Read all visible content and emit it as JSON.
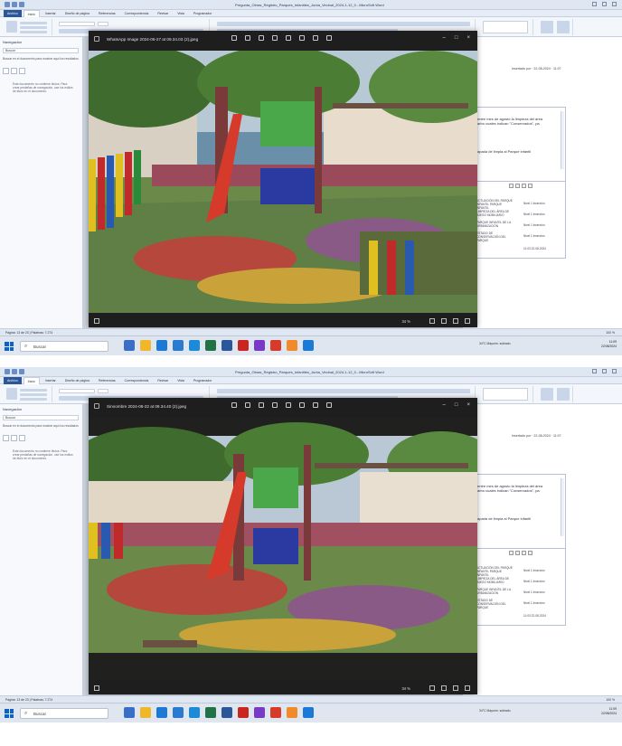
{
  "shots": [
    {
      "window_title": "Pregunta_Obras_Registro_Parques_Infantiles_Junta_Vecinal_2024-1-12_0...MicroSoft Word",
      "ribbon_tabs": [
        "Archivo",
        "Inicio",
        "Insertar",
        "Diseño de página",
        "Referencias",
        "Correspondencia",
        "Revisar",
        "Vista",
        "Programador"
      ],
      "nav": {
        "title": "Navegación",
        "search_placeholder": "Buscar",
        "hint": "Buscar en el documento para mostrar aquí los resultados",
        "detail": "Este documento no contiene títulos. Para crear pestañas de navegación, use los estilos de título en el documento."
      },
      "photo": {
        "title": "WhatsApp Image 2024-06-27 at 09.34.03 (2).jpeg",
        "zoom": "34 %"
      },
      "comment": {
        "line1": "entre mes de agosto la limpieza del área",
        "line2": "arbo cuales indican \"Conservados\", pa",
        "line3": "apada de limpia al Parque infantil"
      },
      "inserted": "Insertado por   ·   22-08-2024 · 11:07",
      "review_rows": [
        {
          "a": "ACTUACIÓN DEL PARQUE INFANTIL PARQUE INFANTIL",
          "b": "Nivel 1 Inserción"
        },
        {
          "a": "LIMPIEZA DEL ÁREA DE JUEGO MOBILIARIO",
          "b": "Nivel 1 Inserción"
        },
        {
          "a": "PARQUE INFANTIL DE LA URBANIZACIÓN",
          "b": "Nivel 1 Inserción"
        },
        {
          "a": "ESTADO DE CONSERVACIÓN DEL PARQUE",
          "b": "Nivel 1 Inserción"
        },
        {
          "a": "",
          "b": "11:03  22-08-2024"
        }
      ],
      "status": {
        "left": "Página: 13 de 23  |  Palabras: 7.274",
        "right": "100 %"
      },
      "taskbar": {
        "search": "Buscar",
        "weather": "34°C  Mayorm. soleado",
        "time": "11:09",
        "date": "22/08/2024"
      }
    },
    {
      "window_title": "Pregunta_Obras_Registro_Parques_Infantiles_Junta_Vecinal_2024-1-12_0...MicroSoft Word",
      "ribbon_tabs": [
        "Archivo",
        "Inicio",
        "Insertar",
        "Diseño de página",
        "Referencias",
        "Correspondencia",
        "Revisar",
        "Vista",
        "Programador"
      ],
      "nav": {
        "title": "Navegación",
        "search_placeholder": "Buscar",
        "hint": "Buscar en el documento para mostrar aquí los resultados",
        "detail": "Este documento no contiene títulos. Para crear pestañas de navegación, use los estilos de título en el documento."
      },
      "photo": {
        "title": "Sinnombre 2024-08-22 at 09.34.40 (2).jpeg",
        "zoom": "34 %"
      },
      "comment": {
        "line1": "entre mes de agosto la limpieza del área",
        "line2": "arbo cuales indican \"Conservados\", pa",
        "line3": "apada de limpia al Parque infantil"
      },
      "inserted": "Insertado por   ·   22-08-2024 · 11:07",
      "review_rows": [
        {
          "a": "ACTUACIÓN DEL PARQUE INFANTIL PARQUE INFANTIL",
          "b": "Nivel 1 Inserción"
        },
        {
          "a": "LIMPIEZA DEL ÁREA DE JUEGO MOBILIARIO",
          "b": "Nivel 1 Inserción"
        },
        {
          "a": "PARQUE INFANTIL DE LA URBANIZACIÓN",
          "b": "Nivel 1 Inserción"
        },
        {
          "a": "ESTADO DE CONSERVACIÓN DEL PARQUE",
          "b": "Nivel 1 Inserción"
        },
        {
          "a": "",
          "b": "11:03  22-08-2024"
        }
      ],
      "status": {
        "left": "Página: 13 de 23  |  Palabras: 7.274",
        "right": "100 %"
      },
      "taskbar": {
        "search": "Buscar",
        "weather": "34°C  Mayorm. soleado",
        "time": "11:09",
        "date": "22/08/2024"
      }
    }
  ],
  "colors": {
    "word_blue": "#2b579a",
    "photos_bg": "#1e1e1e",
    "taskbar": "#dfe6f0"
  }
}
